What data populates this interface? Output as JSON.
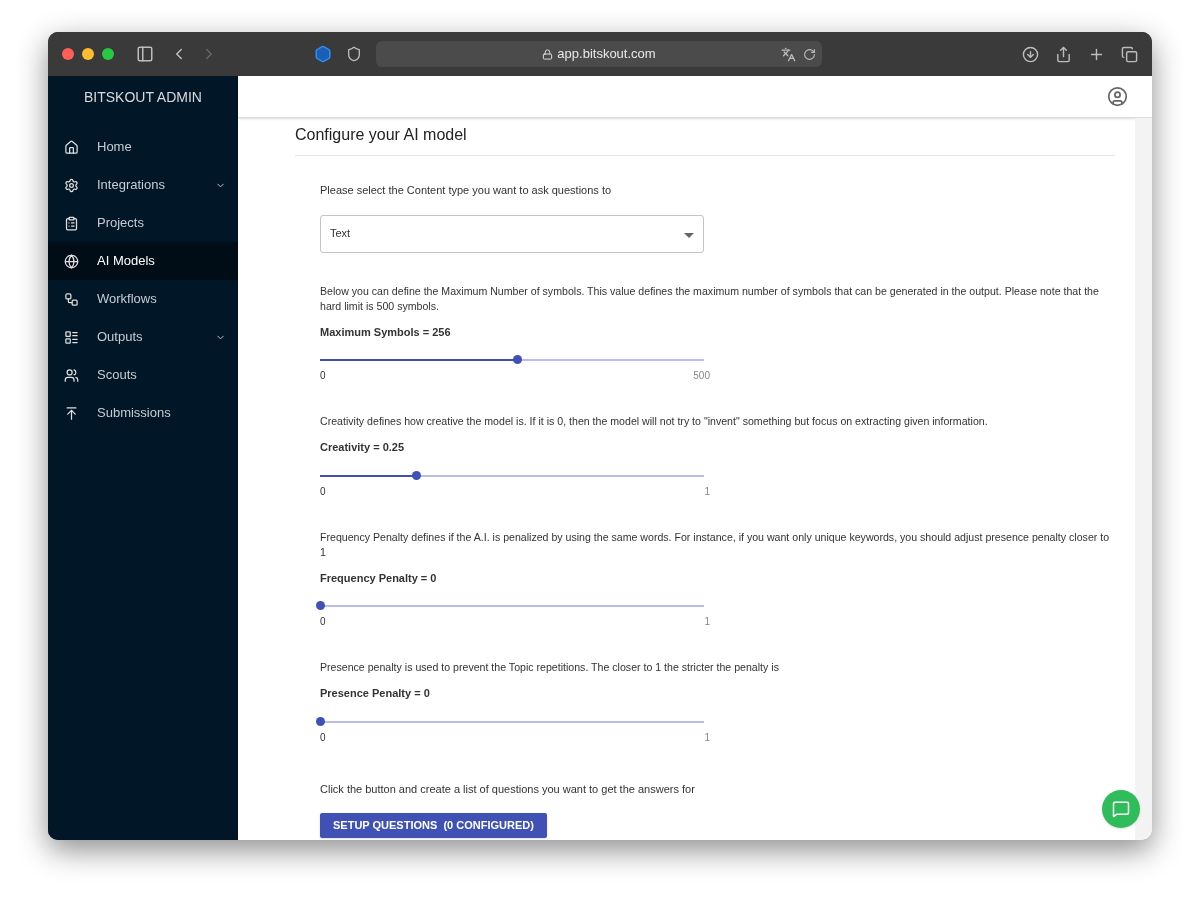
{
  "browser": {
    "url": "app.bitskout.com"
  },
  "sidebar": {
    "title": "BITSKOUT ADMIN",
    "items": [
      {
        "label": "Home",
        "selected": false,
        "expandable": false
      },
      {
        "label": "Integrations",
        "selected": false,
        "expandable": true
      },
      {
        "label": "Projects",
        "selected": false,
        "expandable": false
      },
      {
        "label": "AI Models",
        "selected": true,
        "expandable": false
      },
      {
        "label": "Workflows",
        "selected": false,
        "expandable": false
      },
      {
        "label": "Outputs",
        "selected": false,
        "expandable": true
      },
      {
        "label": "Scouts",
        "selected": false,
        "expandable": false
      },
      {
        "label": "Submissions",
        "selected": false,
        "expandable": false
      }
    ]
  },
  "page": {
    "title": "Configure your AI model",
    "content_type": {
      "prompt": "Please select the Content type you want to ask questions to",
      "value": "Text"
    },
    "sliders": [
      {
        "description": "Below you can define the Maximum Number of symbols. This value defines the maximum number of symbols that can be generated in the output. Please note that the hard limit is 500 symbols.",
        "label": "Maximum Symbols = 256",
        "level": 0.512,
        "min": "0",
        "max": "500"
      },
      {
        "description": "Creativity defines how creative the model is. If it is 0, then the model will not try to \"invent\" something but focus on extracting given information.",
        "label": "Creativity = 0.25",
        "level": 0.25,
        "min": "0",
        "max": "1"
      },
      {
        "description": "Frequency Penalty defines if the A.I. is penalized by using the same words. For instance, if you want only unique keywords, you should adjust presence penalty closer to 1",
        "label": "Frequency Penalty = 0",
        "level": 0,
        "min": "0",
        "max": "1"
      },
      {
        "description": "Presence penalty is used to prevent the Topic repetitions. The closer to 1 the stricter the penalty is",
        "label": "Presence Penalty = 0",
        "level": 0,
        "min": "0",
        "max": "1"
      }
    ],
    "questions": {
      "prompt": "Click the button and create a list of questions you want to get the answers for",
      "button": "SETUP QUESTIONS  (0 CONFIGURED)"
    }
  }
}
